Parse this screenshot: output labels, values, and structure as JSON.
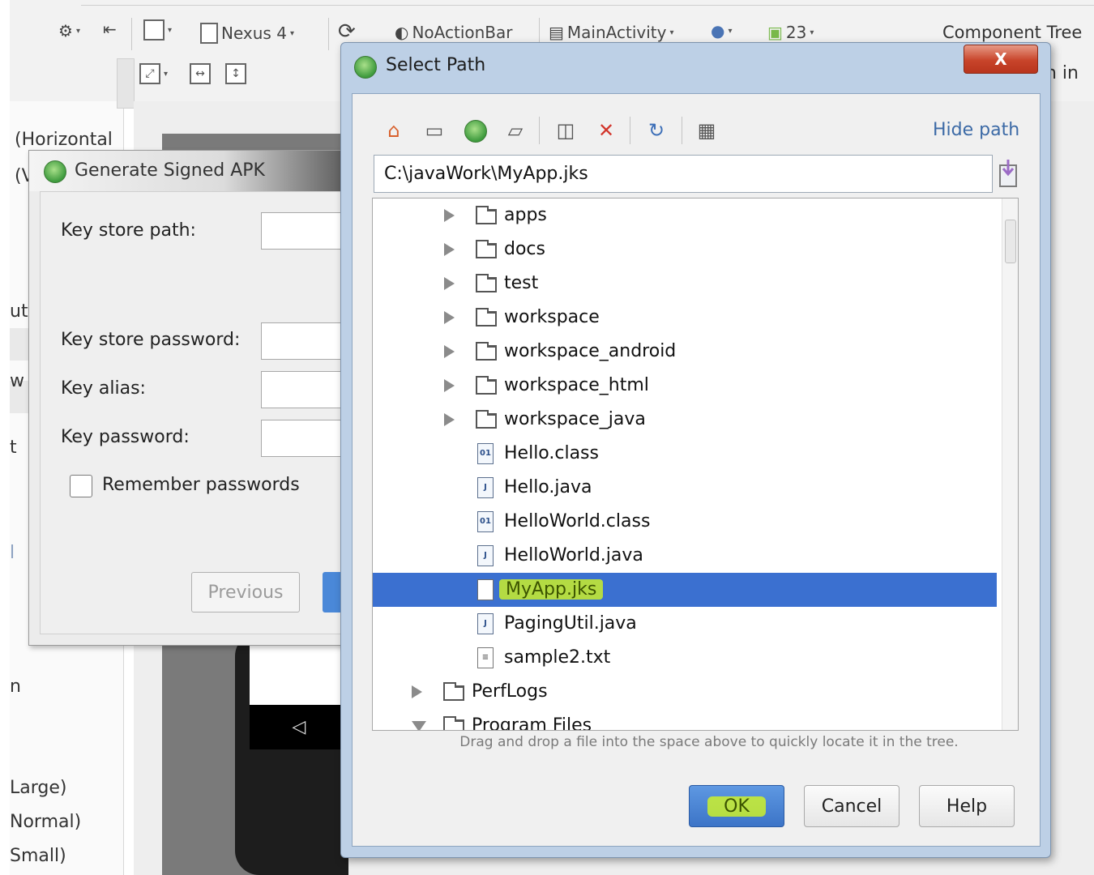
{
  "ide": {
    "toolbar": {
      "device": "Nexus 4",
      "theme": "NoActionBar",
      "activity": "MainActivity",
      "api_level": "23"
    },
    "component_tree": "Component Tree",
    "component_tree_fragment": "n in",
    "left_panel": [
      "(Horizontal",
      "(V",
      "ut",
      "w",
      "t",
      "l",
      "n",
      "Large)",
      "Normal)",
      "Small)"
    ],
    "phone_nav_back": "◁"
  },
  "apk_dialog": {
    "title": "Generate Signed APK",
    "labels": {
      "key_store_path": "Key store path:",
      "key_store_password": "Key store password:",
      "key_alias": "Key alias:",
      "key_password": "Key password:"
    },
    "remember_label": "Remember passwords",
    "remember_checked": false,
    "previous_button": "Previous"
  },
  "select_path": {
    "title": "Select Path",
    "close_label": "X",
    "hide_path": "Hide path",
    "path_value": "C:\\javaWork\\MyApp.jks",
    "tree": [
      {
        "label": "apps",
        "kind": "folder",
        "level": 2,
        "expanded": false
      },
      {
        "label": "docs",
        "kind": "folder",
        "level": 2,
        "expanded": false
      },
      {
        "label": "test",
        "kind": "folder",
        "level": 2,
        "expanded": false
      },
      {
        "label": "workspace",
        "kind": "folder",
        "level": 2,
        "expanded": false
      },
      {
        "label": "workspace_android",
        "kind": "folder",
        "level": 2,
        "expanded": false
      },
      {
        "label": "workspace_html",
        "kind": "folder",
        "level": 2,
        "expanded": false
      },
      {
        "label": "workspace_java",
        "kind": "folder",
        "level": 2,
        "expanded": false
      },
      {
        "label": "Hello.class",
        "kind": "class",
        "level": 2
      },
      {
        "label": "Hello.java",
        "kind": "java",
        "level": 2
      },
      {
        "label": "HelloWorld.class",
        "kind": "class",
        "level": 2
      },
      {
        "label": "HelloWorld.java",
        "kind": "java",
        "level": 2
      },
      {
        "label": "MyApp.jks",
        "kind": "jks",
        "level": 2,
        "selected": true
      },
      {
        "label": "PagingUtil.java",
        "kind": "java",
        "level": 2
      },
      {
        "label": "sample2.txt",
        "kind": "txt",
        "level": 2
      },
      {
        "label": "PerfLogs",
        "kind": "folder",
        "level": 1,
        "expanded": false
      },
      {
        "label": "Program Files",
        "kind": "folder",
        "level": 1,
        "expanded": true
      }
    ],
    "hint": "Drag and drop a file into the space above to quickly locate it in the tree.",
    "ok_button": "OK",
    "cancel_button": "Cancel",
    "help_button": "Help",
    "colors": {
      "selection": "#3b70d0",
      "highlight": "#deff14",
      "hide_path_link": "#3c6aa6"
    }
  }
}
